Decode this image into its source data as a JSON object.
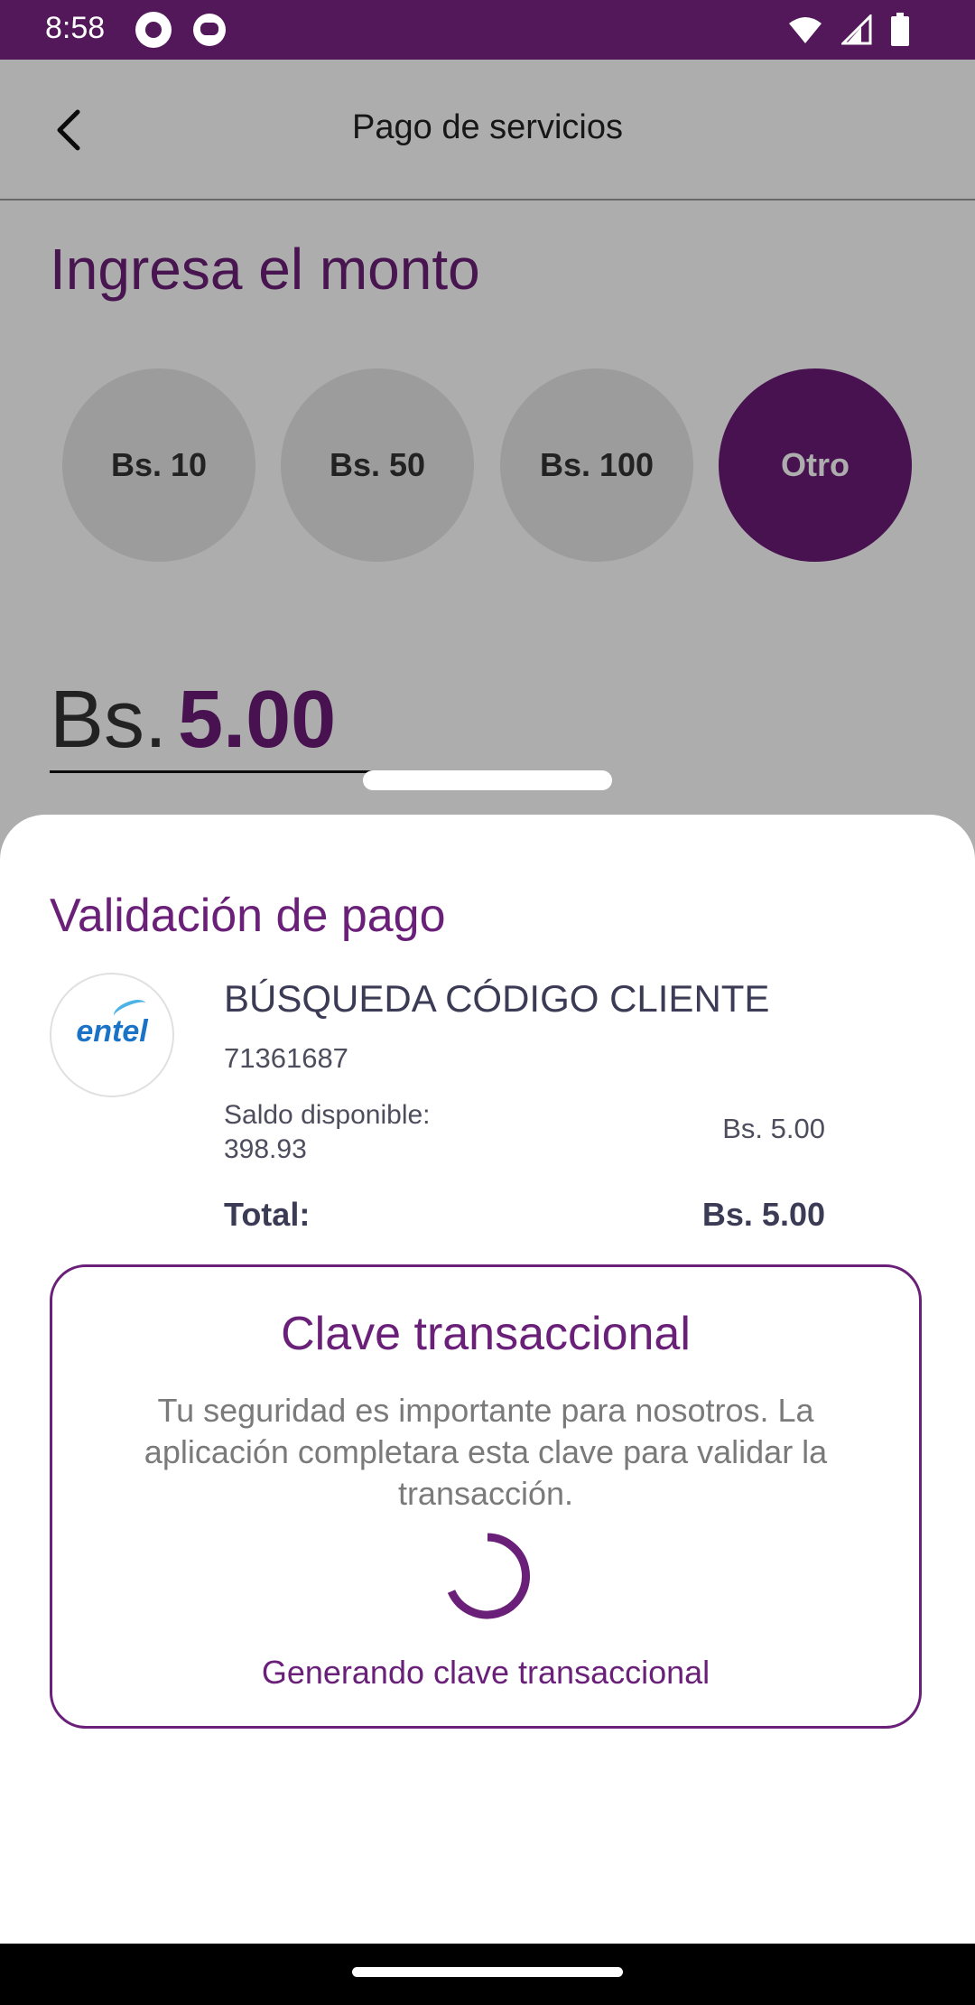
{
  "status_bar": {
    "time": "8:58"
  },
  "app_bar": {
    "title": "Pago de servicios"
  },
  "amount_section": {
    "title": "Ingresa el monto",
    "options": [
      "Bs. 10",
      "Bs. 50",
      "Bs. 100",
      "Otro"
    ],
    "selected_option": "Otro",
    "currency": "Bs.",
    "value": "5.00"
  },
  "sheet": {
    "title": "Validación de pago",
    "provider_logo_text": "entel",
    "service_name": "BÚSQUEDA CÓDIGO CLIENTE",
    "client_code": "71361687",
    "balance_label": "Saldo disponible:",
    "balance_value": "398.93",
    "payment_amount": "Bs. 5.00",
    "total_label": "Total:",
    "total_amount": "Bs. 5.00",
    "key_card": {
      "title": "Clave transaccional",
      "description": "Tu seguridad es importante para nosotros. La aplicación completara esta clave para validar la transacción.",
      "status": "Generando clave transaccional"
    }
  },
  "colors": {
    "brand_purple": "#6a1b78",
    "status_bar": "#52185a",
    "text_dark": "#3b3b55"
  },
  "icons": [
    "back-arrow-icon",
    "wifi-icon",
    "signal-icon",
    "battery-icon",
    "loading-spinner-icon"
  ]
}
